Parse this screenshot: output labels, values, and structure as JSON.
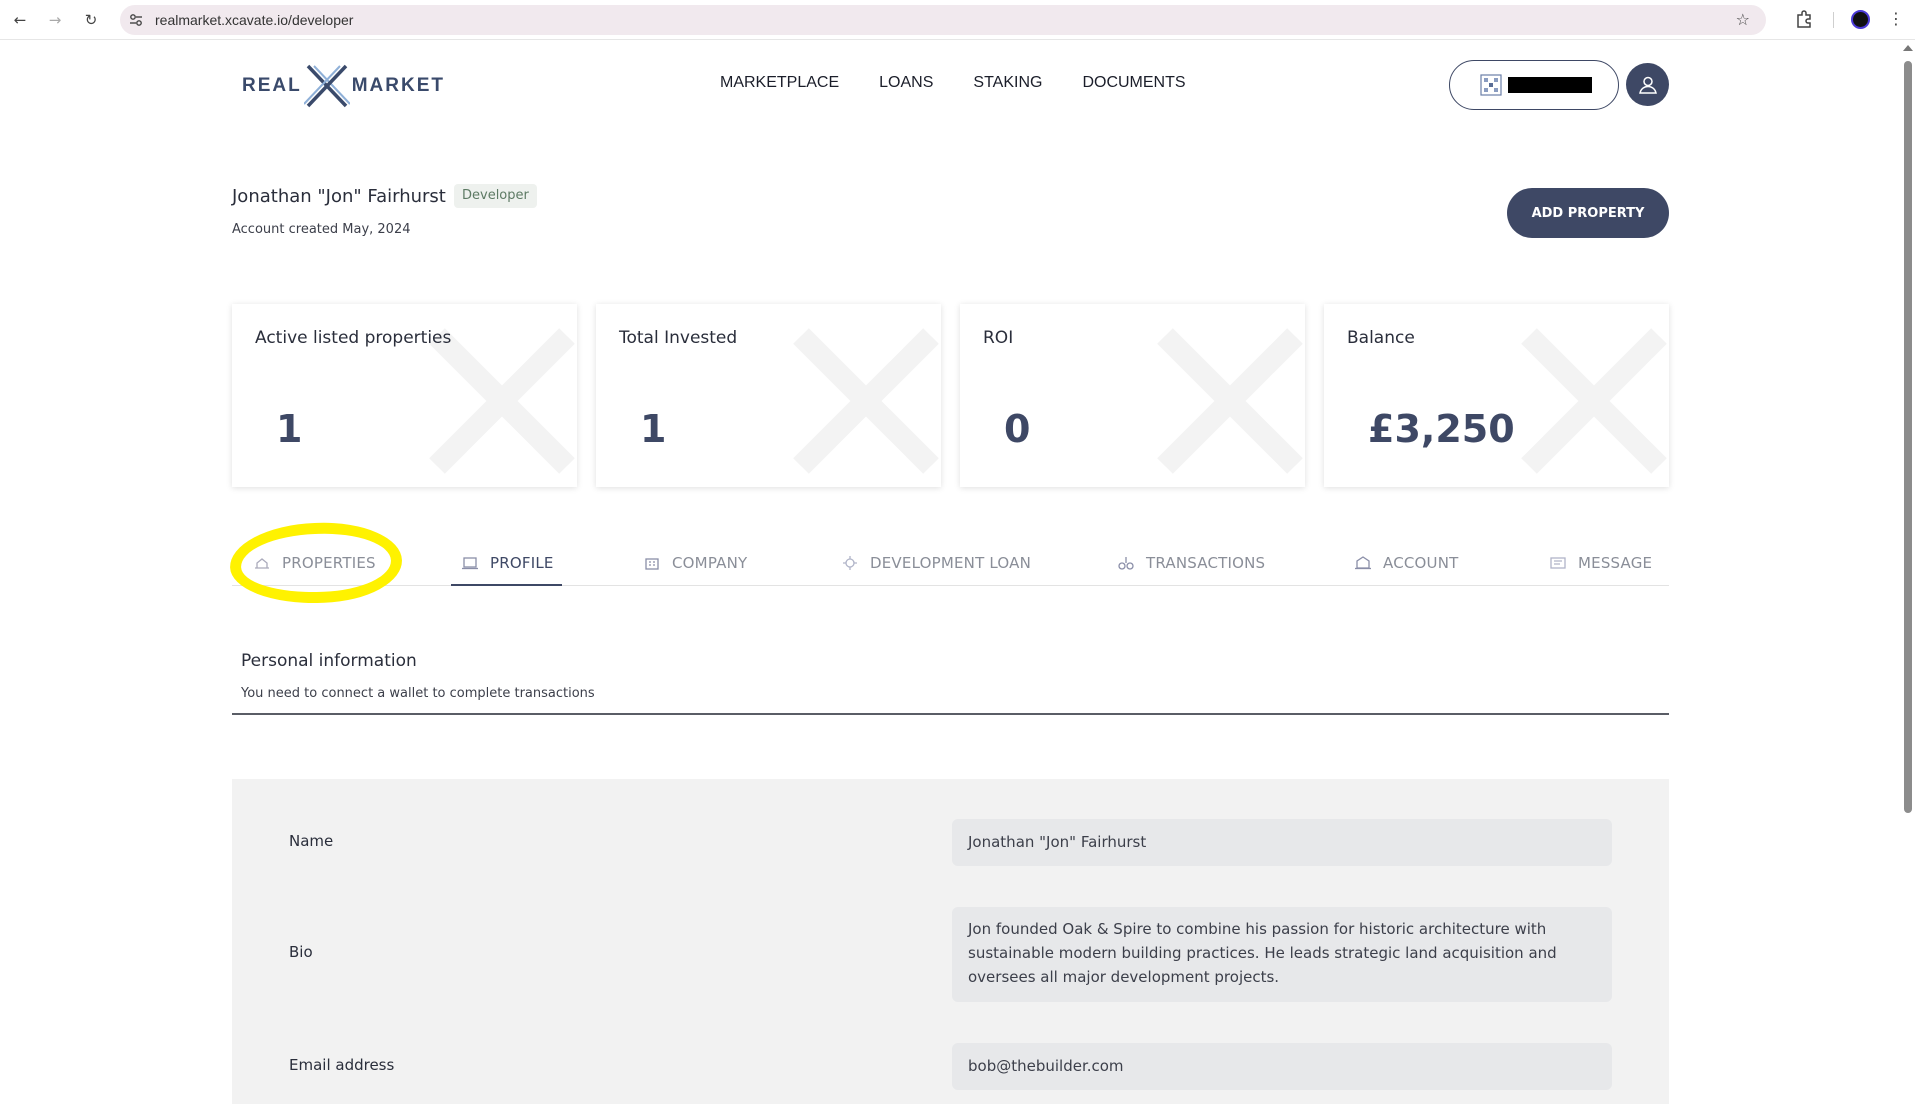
{
  "browser": {
    "url": "realmarket.xcavate.io/developer"
  },
  "header": {
    "logo": {
      "left": "REAL",
      "right": "MARKET"
    },
    "nav": [
      "MARKETPLACE",
      "LOANS",
      "STAKING",
      "DOCUMENTS"
    ]
  },
  "user": {
    "name": "Jonathan \"Jon\" Fairhurst",
    "role": "Developer",
    "created": "Account created May, 2024",
    "add_property_label": "ADD PROPERTY"
  },
  "stats": [
    {
      "label": "Active listed properties",
      "value": "1"
    },
    {
      "label": "Total Invested",
      "value": "1"
    },
    {
      "label": "ROI",
      "value": "0"
    },
    {
      "label": "Balance",
      "value": "£3,250"
    }
  ],
  "tabs": [
    {
      "label": "PROPERTIES",
      "icon": "properties-icon"
    },
    {
      "label": "PROFILE",
      "icon": "profile-icon"
    },
    {
      "label": "COMPANY",
      "icon": "company-icon"
    },
    {
      "label": "DEVELOPMENT LOAN",
      "icon": "development-loan-icon"
    },
    {
      "label": "TRANSACTIONS",
      "icon": "transactions-icon"
    },
    {
      "label": "ACCOUNT",
      "icon": "account-icon"
    },
    {
      "label": "MESSAGE",
      "icon": "message-icon"
    }
  ],
  "active_tab": "PROFILE",
  "personal": {
    "title": "Personal information",
    "subtitle": "You need to connect a wallet to complete transactions"
  },
  "form": {
    "name_label": "Name",
    "name_value": "Jonathan \"Jon\" Fairhurst",
    "bio_label": "Bio",
    "bio_value": "Jon founded Oak & Spire to combine his passion for historic architecture with sustainable modern building practices. He leads strategic land acquisition and oversees all major development projects.",
    "email_label": "Email address",
    "email_value": "bob@thebuilder.com"
  },
  "colors": {
    "brand": "#3e4865",
    "highlight": "#fff200",
    "badge_text": "#5d7a64"
  }
}
